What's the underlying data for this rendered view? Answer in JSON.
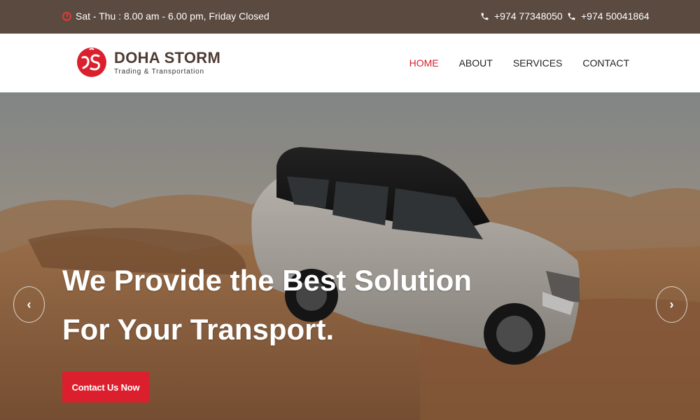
{
  "topbar": {
    "hours": "Sat - Thu : 8.00 am - 6.00 pm, Friday Closed",
    "phone1": "+974 77348050",
    "phone2": "+974 50041864",
    "icons": {
      "hours": "clock-icon",
      "phone": "phone-icon"
    }
  },
  "header": {
    "brand": "DOHA STORM",
    "tagline": "Trading & Transportation",
    "nav": [
      "HOME",
      "ABOUT",
      "SERVICES",
      "CONTACT"
    ],
    "active_nav": "HOME"
  },
  "hero": {
    "title_line1": "We Provide the Best Solution",
    "title_line2": "For Your Transport.",
    "cta": "Contact Us Now",
    "prev_label": "‹",
    "next_label": "›"
  },
  "colors": {
    "topbar": "#5b4a40",
    "accent": "#dc1f2d",
    "brand_text": "#4e3b33"
  }
}
